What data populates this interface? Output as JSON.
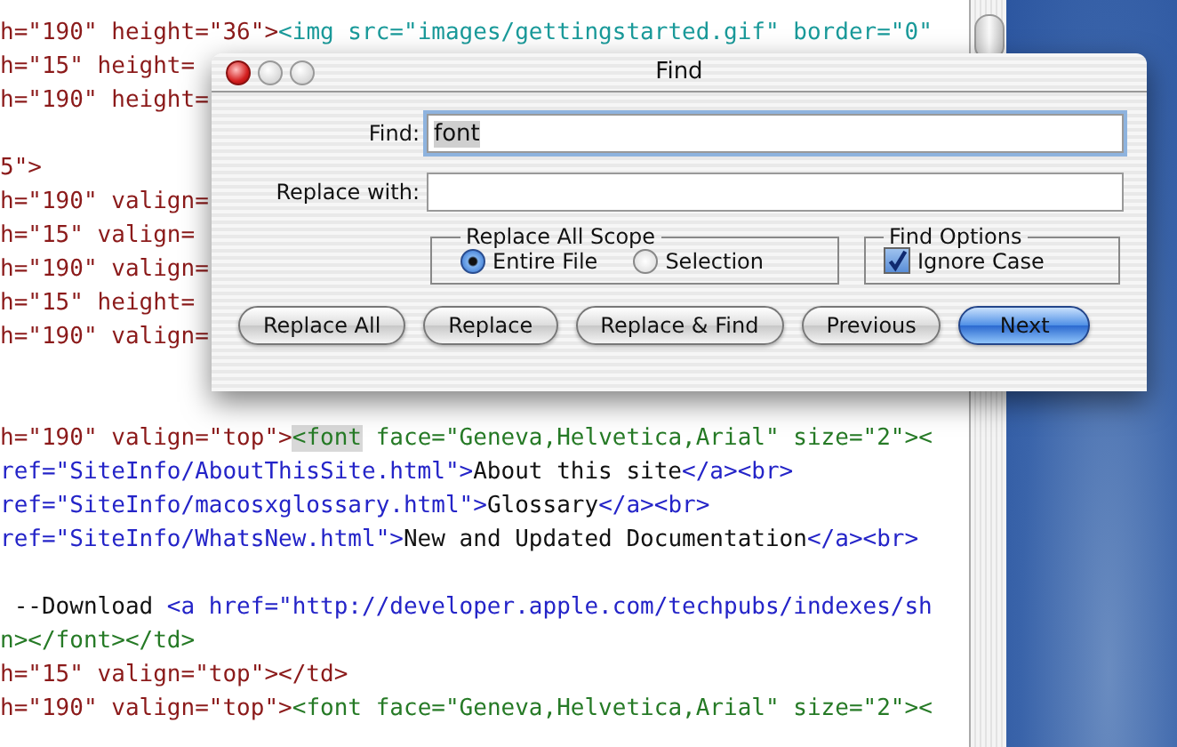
{
  "editor": {
    "lines": [
      {
        "kind": "code",
        "tokens": [
          {
            "kind": "attr",
            "text": "h=\"190\" height=\"36\">"
          },
          {
            "kind": "img",
            "text": "<img src=\"images/gettingstarted.gif\" border=\"0\""
          }
        ]
      },
      {
        "kind": "code",
        "tokens": [
          {
            "kind": "attr",
            "text": "h=\"15\" height="
          }
        ]
      },
      {
        "kind": "code",
        "tokens": [
          {
            "kind": "attr",
            "text": "h=\"190\" height="
          }
        ]
      },
      {
        "kind": "blank"
      },
      {
        "kind": "code",
        "tokens": [
          {
            "kind": "attr",
            "text": "5\">"
          }
        ]
      },
      {
        "kind": "code",
        "tokens": [
          {
            "kind": "attr",
            "text": "h=\"190\" valign="
          }
        ]
      },
      {
        "kind": "code",
        "tokens": [
          {
            "kind": "attr",
            "text": "h=\"15\" valign="
          }
        ]
      },
      {
        "kind": "code",
        "tokens": [
          {
            "kind": "attr",
            "text": "h=\"190\" valign="
          }
        ]
      },
      {
        "kind": "code",
        "tokens": [
          {
            "kind": "attr",
            "text": "h=\"15\" height="
          }
        ]
      },
      {
        "kind": "code",
        "tokens": [
          {
            "kind": "attr",
            "text": "h=\"190\" valign="
          }
        ]
      },
      {
        "kind": "blank"
      },
      {
        "kind": "blank"
      },
      {
        "kind": "code",
        "tokens": [
          {
            "kind": "attr",
            "text": "h=\"190\" valign=\"top\">"
          },
          {
            "kind": "match",
            "text": "<font"
          },
          {
            "kind": "font",
            "text": " face=\"Geneva,Helvetica,Arial\" size=\"2\"><"
          }
        ]
      },
      {
        "kind": "code",
        "tokens": [
          {
            "kind": "link",
            "text": "ref=\"SiteInfo/AboutThisSite.html\">"
          },
          {
            "kind": "text",
            "text": "About this site"
          },
          {
            "kind": "link",
            "text": "</a><br>"
          }
        ]
      },
      {
        "kind": "code",
        "tokens": [
          {
            "kind": "link",
            "text": "ref=\"SiteInfo/macosxglossary.html\">"
          },
          {
            "kind": "text",
            "text": "Glossary"
          },
          {
            "kind": "link",
            "text": "</a><br>"
          }
        ]
      },
      {
        "kind": "code",
        "tokens": [
          {
            "kind": "link",
            "text": "ref=\"SiteInfo/WhatsNew.html\">"
          },
          {
            "kind": "text",
            "text": "New and Updated Documentation"
          },
          {
            "kind": "link",
            "text": "</a><br>"
          }
        ]
      },
      {
        "kind": "blank"
      },
      {
        "kind": "code",
        "tokens": [
          {
            "kind": "text",
            "text": " --Download "
          },
          {
            "kind": "link",
            "text": "<a href=\"http://developer.apple.com/techpubs/indexes/sh"
          }
        ]
      },
      {
        "kind": "code",
        "tokens": [
          {
            "kind": "font",
            "text": "n></font></td>"
          }
        ]
      },
      {
        "kind": "code",
        "tokens": [
          {
            "kind": "attr",
            "text": "h=\"15\" valign=\"top\"></td>"
          }
        ]
      },
      {
        "kind": "code",
        "tokens": [
          {
            "kind": "attr",
            "text": "h=\"190\" valign=\"top\">"
          },
          {
            "kind": "font",
            "text": "<font face=\"Geneva,Helvetica,Arial\" size=\"2\"><"
          }
        ]
      }
    ]
  },
  "find_dialog": {
    "title": "Find",
    "find": {
      "label": "Find:",
      "value": "font"
    },
    "replace": {
      "label": "Replace with:"
    },
    "scope": {
      "title": "Replace All Scope",
      "options": [
        {
          "label": "Entire File",
          "selected": true
        },
        {
          "label": "Selection",
          "selected": false
        }
      ]
    },
    "find_options": {
      "title": "Find Options",
      "checkboxes": [
        {
          "label": "Ignore Case",
          "checked": true
        }
      ]
    },
    "buttons": [
      {
        "label": "Replace All",
        "default": false
      },
      {
        "label": "Replace",
        "default": false
      },
      {
        "label": "Replace & Find",
        "default": false
      },
      {
        "label": "Previous",
        "default": false
      },
      {
        "label": "Next",
        "default": true
      }
    ]
  }
}
